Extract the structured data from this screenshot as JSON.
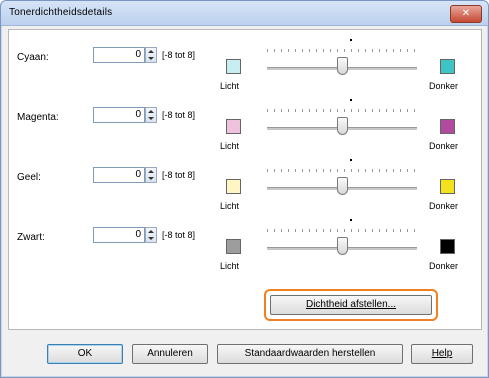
{
  "window": {
    "title": "Tonerdichtheidsdetails",
    "close_glyph": "✕"
  },
  "rows": [
    {
      "label": "Cyaan:",
      "value": "0",
      "range": "[-8 tot 8]",
      "light_label": "Licht",
      "dark_label": "Donker",
      "light_color": "#c8eef2",
      "dark_color": "#3ec4c4",
      "level": 0.5
    },
    {
      "label": "Magenta:",
      "value": "0",
      "range": "[-8 tot 8]",
      "light_label": "Licht",
      "dark_label": "Donker",
      "light_color": "#efc2dd",
      "dark_color": "#b24aa0",
      "level": 0.5
    },
    {
      "label": "Geel:",
      "value": "0",
      "range": "[-8 tot 8]",
      "light_label": "Licht",
      "dark_label": "Donker",
      "light_color": "#fff6c4",
      "dark_color": "#f2e11c",
      "level": 0.5
    },
    {
      "label": "Zwart:",
      "value": "0",
      "range": "[-8 tot 8]",
      "light_label": "Licht",
      "dark_label": "Donker",
      "light_color": "#9d9d9d",
      "dark_color": "#000000",
      "level": 0.5
    }
  ],
  "buttons": {
    "density": "Dichtheid afstellen...",
    "ok": "OK",
    "cancel": "Annuleren",
    "defaults": "Standaardwaarden herstellen",
    "help": "Help"
  },
  "colors": {
    "highlight": "#f08020",
    "title_bar": "#c9dbf2"
  }
}
